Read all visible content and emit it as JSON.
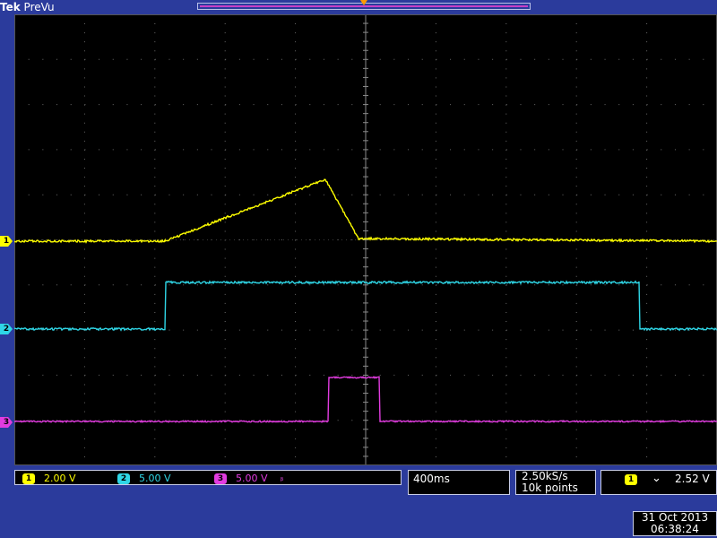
{
  "header": {
    "brand": "Tek",
    "mode": "PreVu"
  },
  "colors": {
    "ch1": "#ffff00",
    "ch2": "#2fd6e6",
    "ch3": "#e23ce0",
    "background": "#2b3b9c",
    "trigger_marker": "#ff9a00"
  },
  "channels": [
    {
      "number": "1",
      "scale": "2.00 V"
    },
    {
      "number": "2",
      "scale": "5.00 V"
    },
    {
      "number": "3",
      "scale": "5.00 V"
    }
  ],
  "ch3_bandwidth_icon": "bandwidth-limit-icon",
  "timebase": "400ms",
  "acquisition": {
    "sample_rate": "2.50kS/s",
    "record_length": "10k points"
  },
  "trigger": {
    "source": "1",
    "slope_icon": "falling-edge-icon",
    "level": "2.52 V"
  },
  "timestamp": {
    "date": "31 Oct  2013",
    "time": "06:38:24"
  }
}
